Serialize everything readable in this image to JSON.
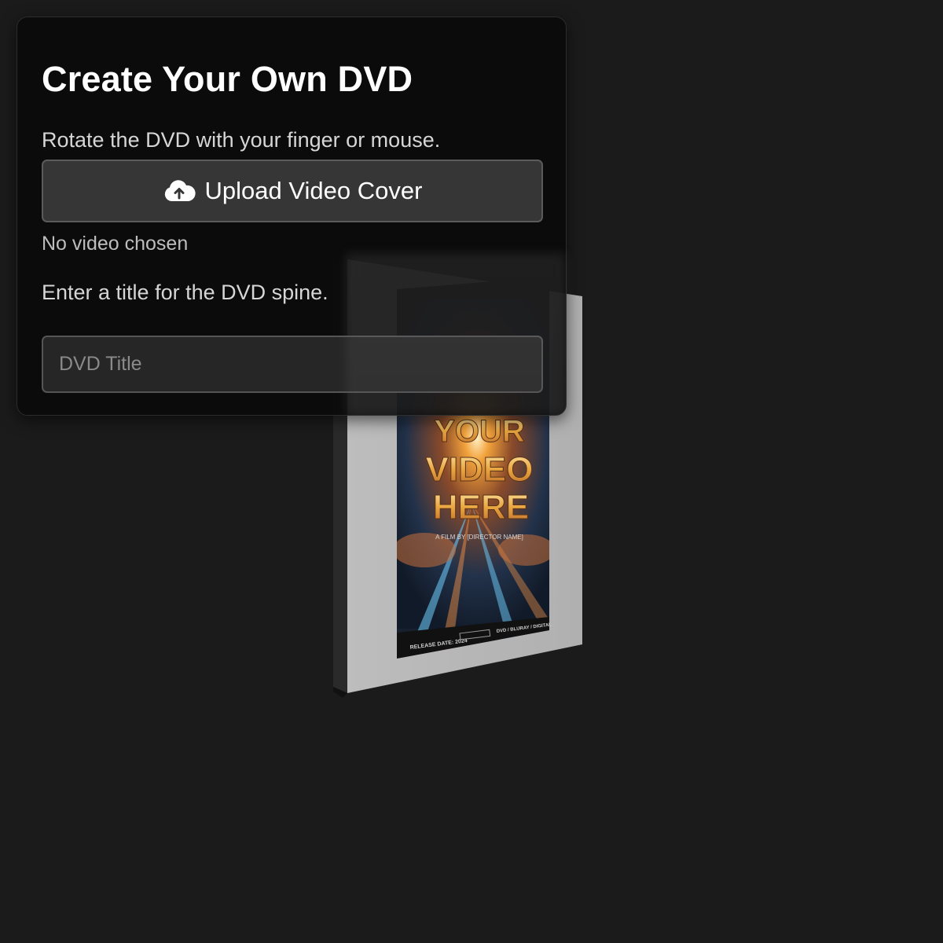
{
  "panel": {
    "title": "Create Your Own DVD",
    "subtitle": "Rotate the DVD with your finger or mouse.",
    "upload_button_label": "Upload Video Cover",
    "upload_icon": "cloud-upload-icon",
    "file_status": "No video chosen",
    "spine_prompt": "Enter a title for the DVD spine.",
    "title_input_placeholder": "DVD Title",
    "title_input_value": ""
  },
  "dvd": {
    "cover": {
      "headline": [
        "YOUR",
        "VIDEO",
        "HERE"
      ],
      "credit": "A FILM BY [DIRECTOR NAME]",
      "release": "RELEASE DATE: 2024",
      "formats": "DVD / BLURAY / DIGITAL"
    }
  },
  "colors": {
    "background": "#1b1b1b",
    "panel": "#0a0a0a",
    "button": "#363636",
    "case": "#b5b5b5",
    "cover_accent": "#f0a63a"
  }
}
